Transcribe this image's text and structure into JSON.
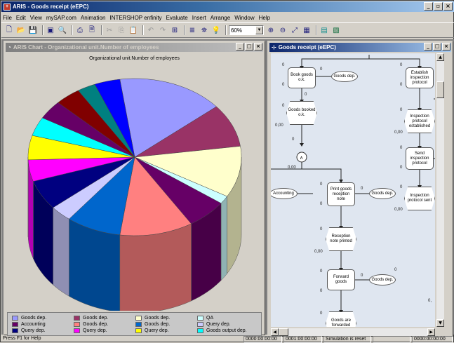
{
  "window": {
    "title": "ARIS - Goods receipt (eEPC)"
  },
  "menu": [
    "File",
    "Edit",
    "View",
    "mySAP.com",
    "Animation",
    "INTERSHOP enfinity",
    "Evaluate",
    "Insert",
    "Arrange",
    "Window",
    "Help"
  ],
  "toolbar": {
    "zoom_value": "60%"
  },
  "chart_window": {
    "title": "ARIS Chart - Organizational unit.Number of employees",
    "chart_data": {
      "type": "pie",
      "title": "Organizational unit.Number of employees",
      "categories": [
        "Goods dep.",
        "Goods dep.",
        "Goods dep.",
        "QA",
        "Accounting",
        "Goods dep.",
        "Goods dep.",
        "Query dep.",
        "Query dep.",
        "Query dep.",
        "Query dep.",
        "Goods output dep."
      ],
      "colors": [
        "#9999ff",
        "#993366",
        "#ffffcc",
        "#ccffff",
        "#660066",
        "#ff8080",
        "#0066cc",
        "#ccccff",
        "#000080",
        "#ff00ff",
        "#ffff00",
        "#00ffff"
      ],
      "legend": [
        [
          {
            "label": "Goods dep.",
            "color": "#9999ff"
          },
          {
            "label": "Goods dep.",
            "color": "#993366"
          },
          {
            "label": "Goods dep.",
            "color": "#ffffcc"
          },
          {
            "label": "QA",
            "color": "#ccffff"
          }
        ],
        [
          {
            "label": "Accounting",
            "color": "#660066"
          },
          {
            "label": "Goods dep.",
            "color": "#ff8080"
          },
          {
            "label": "Goods dep.",
            "color": "#0066cc"
          },
          {
            "label": "Query dep.",
            "color": "#ccccff"
          }
        ],
        [
          {
            "label": "Query dep.",
            "color": "#000080"
          },
          {
            "label": "Query dep.",
            "color": "#ff00ff"
          },
          {
            "label": "Query dep.",
            "color": "#ffff00"
          },
          {
            "label": "Goods output dep.",
            "color": "#00ffff"
          }
        ]
      ],
      "legend_position": "bottom"
    }
  },
  "epc_window": {
    "title": "Goods receipt (eEPC)",
    "nodes": {
      "book": "Book goods o.k.",
      "goods_booked": "Goods booked o.k.",
      "establish": "Establish inspection protocol",
      "insp_established": "Inspection protocol established",
      "send": "Send inspection protocol",
      "insp_sent": "Inspection protocol sent",
      "print": "Print goods reception note",
      "reception_printed": "Reception note printed",
      "forward": "Forward goods",
      "forwarded": "Goods are forwarded",
      "accounting": "Accounting",
      "goods_dep1": "Goods dep.",
      "goods_dep2": "Goods dep.",
      "goods_dep3": "Goods dep."
    },
    "labels": {
      "zero": "0",
      "zero_comma": "0,00",
      "clipped": "0,"
    }
  },
  "status": {
    "help": "Press F1 for Help",
    "time1": "0000:00:00:00",
    "time2": "0001:00:00:00",
    "sim": "Simulation is reset",
    "time3": "0000:00:00:00"
  }
}
